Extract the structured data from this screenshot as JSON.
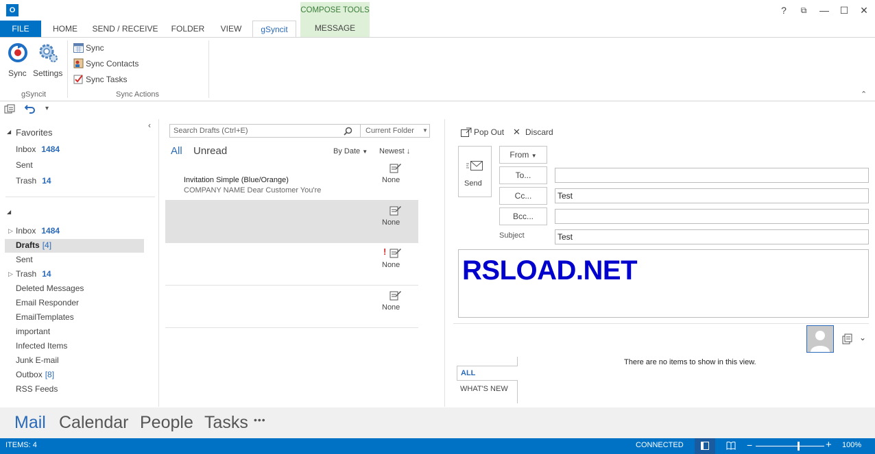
{
  "window": {
    "app_icon": "O",
    "controls": [
      "?",
      "⧉",
      "—",
      "☐",
      "✕"
    ]
  },
  "tabs": {
    "file": "FILE",
    "home": "HOME",
    "send_receive": "SEND / RECEIVE",
    "folder": "FOLDER",
    "view": "VIEW",
    "gsyncit": "gSyncit",
    "compose_tools": "COMPOSE TOOLS",
    "message": "MESSAGE"
  },
  "ribbon": {
    "sync_big": "Sync",
    "settings": "Settings",
    "group_gsyncit": "gSyncit",
    "sync": "Sync",
    "sync_contacts": "Sync Contacts",
    "sync_tasks": "Sync Tasks",
    "group_sync_actions": "Sync Actions"
  },
  "favorites": {
    "header": "Favorites",
    "items": [
      {
        "label": "Inbox",
        "count": "1484"
      },
      {
        "label": "Sent",
        "count": ""
      },
      {
        "label": "Trash",
        "count": "14"
      }
    ]
  },
  "folders": {
    "items": [
      {
        "label": "Inbox",
        "count": "1484"
      },
      {
        "label": "Drafts",
        "count": "[4]"
      },
      {
        "label": "Sent",
        "count": ""
      },
      {
        "label": "Trash",
        "count": "14"
      },
      {
        "label": "Deleted Messages",
        "count": ""
      },
      {
        "label": "Email Responder",
        "count": ""
      },
      {
        "label": "EmailTemplates",
        "count": ""
      },
      {
        "label": "important",
        "count": ""
      },
      {
        "label": "Infected Items",
        "count": ""
      },
      {
        "label": "Junk E-mail",
        "count": ""
      },
      {
        "label": "Outbox",
        "count": "[8]"
      },
      {
        "label": "RSS Feeds",
        "count": ""
      }
    ]
  },
  "list": {
    "search_placeholder": "Search Drafts (Ctrl+E)",
    "scope": "Current Folder",
    "filter_all": "All",
    "filter_unread": "Unread",
    "sort_by": "By Date",
    "sort_order": "Newest",
    "messages": [
      {
        "subject": "Invitation Simple (Blue/Orange)",
        "preview": "COMPANY NAME  Dear Customer  You're",
        "flag": "None"
      },
      {
        "subject": "",
        "preview": "",
        "flag": "None"
      },
      {
        "subject": "",
        "preview": "",
        "flag": "None",
        "important": "!"
      },
      {
        "subject": "",
        "preview": "",
        "flag": "None"
      }
    ]
  },
  "compose": {
    "pop_out": "Pop Out",
    "discard": "Discard",
    "send": "Send",
    "from": "From",
    "to": "To...",
    "cc": "Cc...",
    "bcc": "Bcc...",
    "subject_label": "Subject",
    "to_value": "",
    "cc_value": "Test",
    "bcc_value": "",
    "subject_value": "Test",
    "body": "RSLOAD.NET"
  },
  "people_pane": {
    "empty_message": "There are no items to show in this view.",
    "tab_all": "ALL",
    "tab_whats_new": "WHAT'S NEW"
  },
  "navbar": {
    "mail": "Mail",
    "calendar": "Calendar",
    "people": "People",
    "tasks": "Tasks",
    "more": "•••"
  },
  "status": {
    "items": "ITEMS: 4",
    "connection": "CONNECTED",
    "zoom": "100%",
    "zoom_level": 0.62
  },
  "colors": {
    "accent": "#0072c6",
    "compose_tools_bg": "#dff0d8",
    "link_blue": "#2a6ab8",
    "body_text": "#0000cc"
  }
}
